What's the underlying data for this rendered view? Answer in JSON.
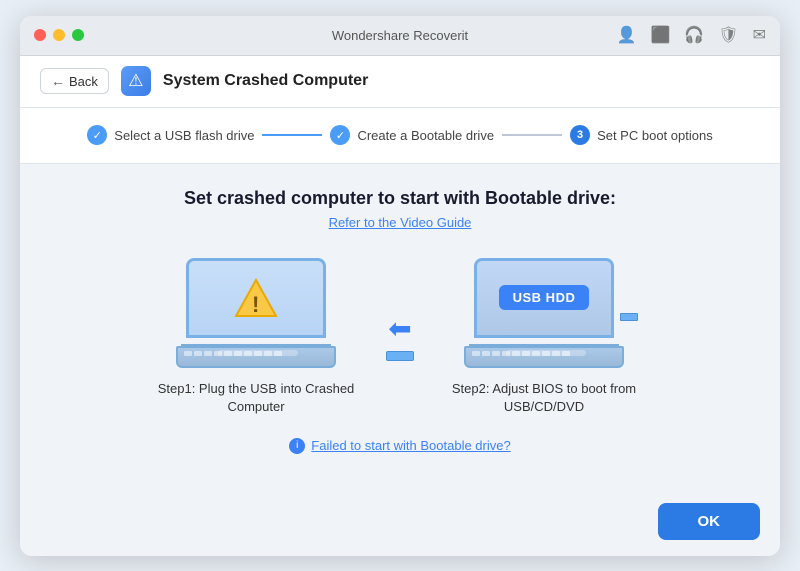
{
  "titleBar": {
    "title": "Wondershare Recoverit"
  },
  "header": {
    "backLabel": "Back",
    "iconLabel": "⚠",
    "title": "System Crashed Computer"
  },
  "steps": [
    {
      "label": "Select a USB flash drive",
      "state": "done"
    },
    {
      "label": "Create a Bootable drive",
      "state": "done"
    },
    {
      "label": "Set PC boot options",
      "state": "active",
      "num": "3"
    }
  ],
  "main": {
    "title": "Set crashed computer to start with Bootable drive:",
    "videoGuideLabel": "Refer to the Video Guide",
    "step1Caption": "Step1:  Plug the USB into Crashed\nComputer",
    "step2Caption": "Step2: Adjust BIOS to boot from USB/CD/DVD",
    "usbHddLabel": "USB HDD",
    "failedLinkLabel": "Failed to start with Bootable drive?",
    "okLabel": "OK"
  }
}
